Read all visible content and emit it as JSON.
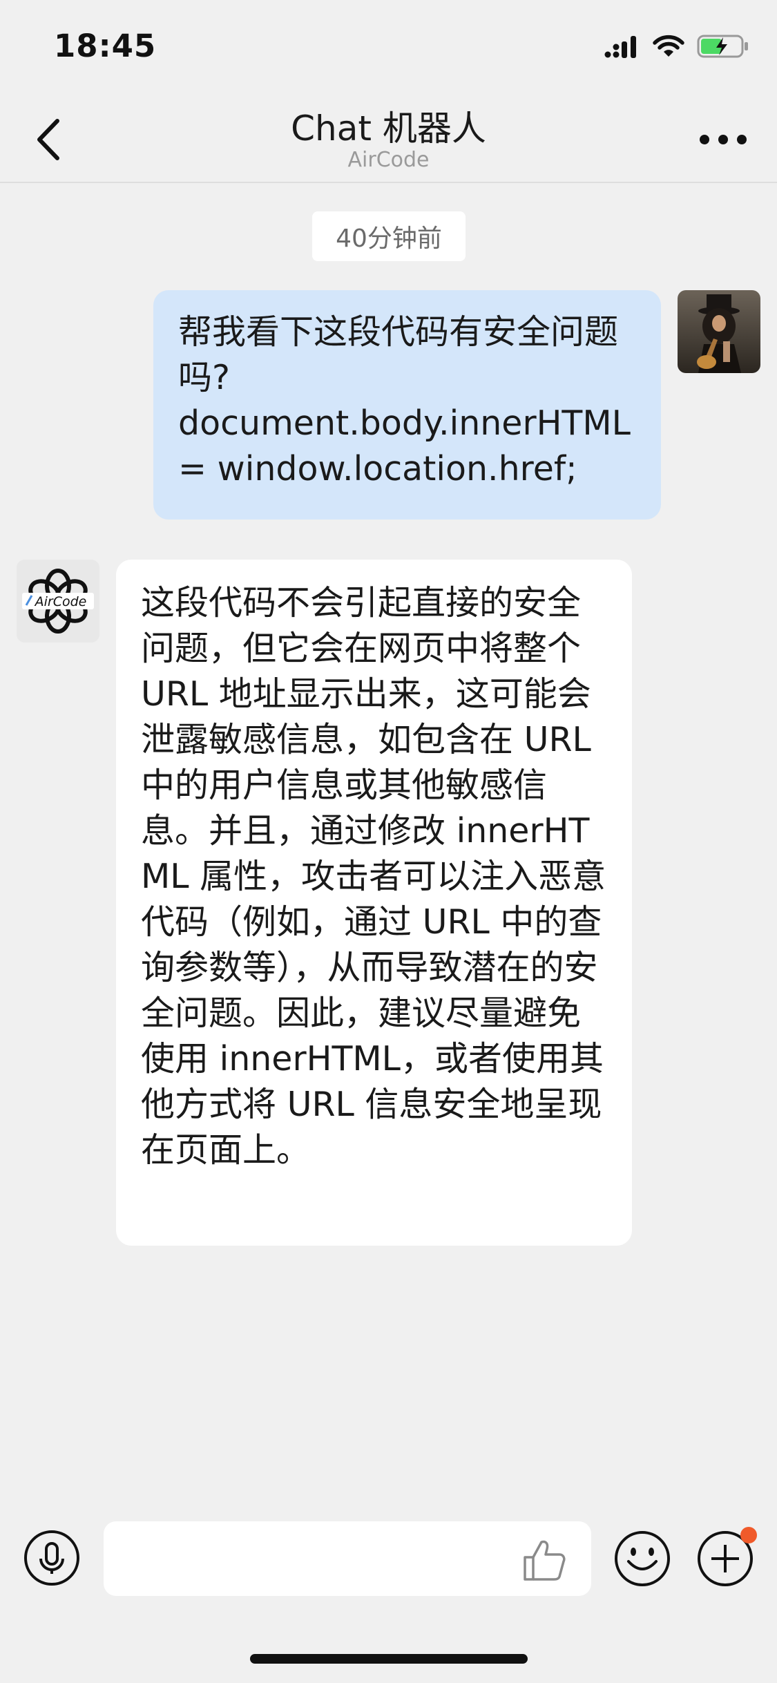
{
  "status_bar": {
    "time": "18:45",
    "icons": [
      "cellular-signal-icon",
      "wifi-icon",
      "battery-charging-icon"
    ],
    "battery_color": "#4cd964"
  },
  "nav": {
    "title": "Chat 机器人",
    "subtitle": "AirCode",
    "back_icon": "chevron-left-icon",
    "more_icon": "more-dots-icon"
  },
  "conversation": {
    "timestamp": "40分钟前",
    "messages": [
      {
        "sender": "user",
        "text": "帮我看下这段代码有安全问题吗?\ndocument.body.innerHTML = window.location.href;",
        "bubble_color": "#d4e6fa"
      },
      {
        "sender": "bot",
        "avatar_label": "AirCode",
        "text": "这段代码不会引起直接的安全问题，但它会在网页中将整个 URL 地址显示出来，这可能会泄露敏感信息，如包含在 URL 中的用户信息或其他敏感信息。并且，通过修改 innerHTML 属性，攻击者可以注入恶意代码（例如，通过 URL 中的查询参数等），从而导致潜在的安全问题。因此，建议尽量避免使用 innerHTML，或者使用其他方式将 URL 信息安全地呈现在页面上。",
        "bubble_color": "#ffffff"
      }
    ]
  },
  "input_bar": {
    "placeholder": "",
    "value": "",
    "icons": [
      "voice-icon",
      "thumbs-up-icon",
      "emoji-icon",
      "plus-icon"
    ],
    "notification_dot_color": "#f05a2a"
  }
}
